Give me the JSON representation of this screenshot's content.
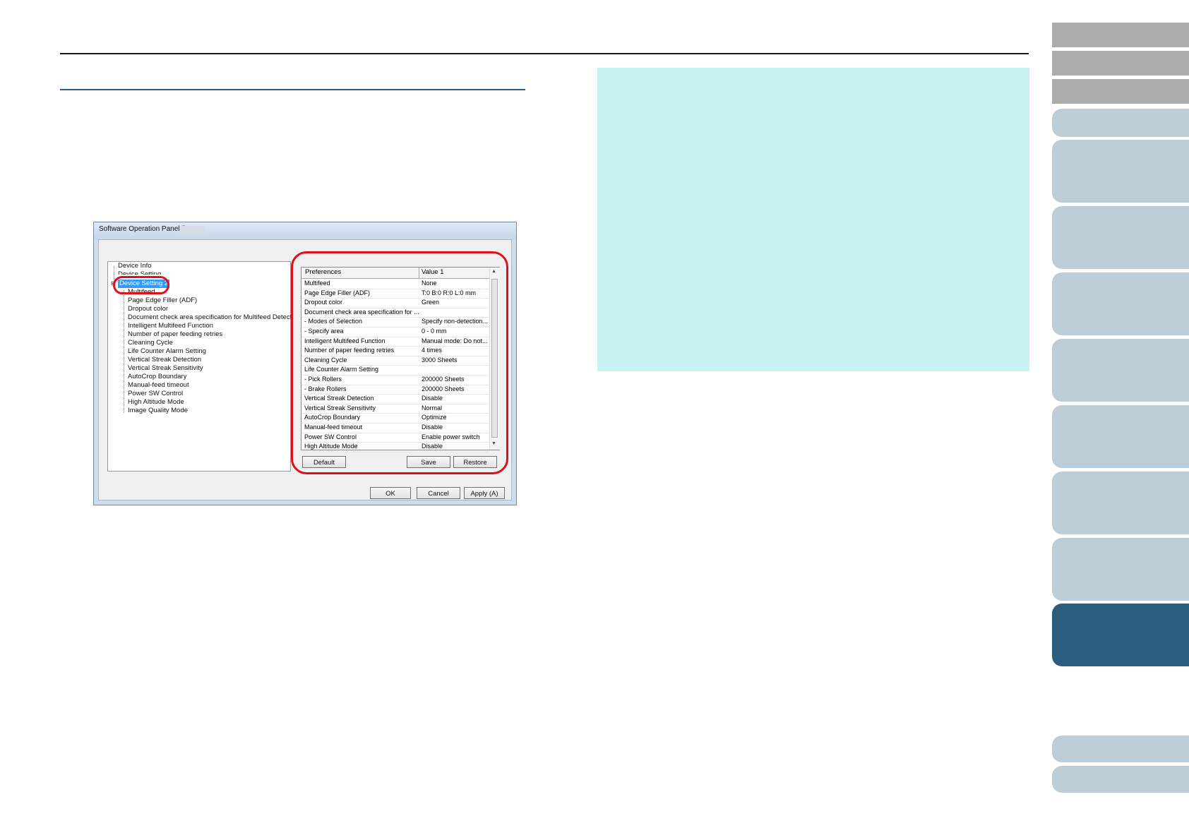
{
  "dialog": {
    "title": "Software Operation Panel fi-",
    "tree": [
      "Device Info",
      "Device Setting",
      "Device Setting 2",
      "Multifeed",
      "Page Edge Filler (ADF)",
      "Dropout color",
      "Document check area specification for Multifeed Detection",
      "Intelligent Multifeed Function",
      "Number of paper feeding retries",
      "Cleaning Cycle",
      "Life Counter Alarm Setting",
      "Vertical Streak Detection",
      "Vertical Streak Sensitivity",
      "AutoCrop Boundary",
      "Manual-feed timeout",
      "Power SW Control",
      "High Altitude Mode",
      "Image Quality Mode"
    ],
    "grid_headers": [
      "Preferences",
      "Value 1"
    ],
    "grid_rows": [
      [
        "Multifeed",
        "None"
      ],
      [
        "Page Edge Filler (ADF)",
        "T:0  B:0  R:0  L:0 mm"
      ],
      [
        "Dropout color",
        "Green"
      ],
      [
        "Document check area specification for ...",
        ""
      ],
      [
        " - Modes of Selection",
        "Specify non-detection..."
      ],
      [
        " - Specify area",
        "0 - 0 mm"
      ],
      [
        "Intelligent Multifeed Function",
        "Manual mode: Do not..."
      ],
      [
        "Number of paper feeding retries",
        "4 times"
      ],
      [
        "Cleaning Cycle",
        "3000 Sheets"
      ],
      [
        "Life Counter Alarm Setting",
        ""
      ],
      [
        " - Pick Rollers",
        "200000 Sheets"
      ],
      [
        " - Brake Rollers",
        "200000 Sheets"
      ],
      [
        "Vertical Streak Detection",
        "Disable"
      ],
      [
        "Vertical Streak Sensitivity",
        "Normal"
      ],
      [
        "AutoCrop Boundary",
        "Optimize"
      ],
      [
        "Manual-feed timeout",
        "Disable"
      ],
      [
        "Power SW Control",
        "Enable power switch"
      ],
      [
        "High Altitude Mode",
        "Disable"
      ]
    ],
    "buttons": {
      "default": "Default",
      "save": "Save",
      "restore": "Restore",
      "ok": "OK",
      "cancel": "Cancel",
      "apply": "Apply (A)"
    }
  },
  "colors": {
    "note_box": "#c7f2f1",
    "highlight": "#e0101a",
    "nav_active": "#2b5e7e",
    "nav_light": "#bccdd8"
  }
}
